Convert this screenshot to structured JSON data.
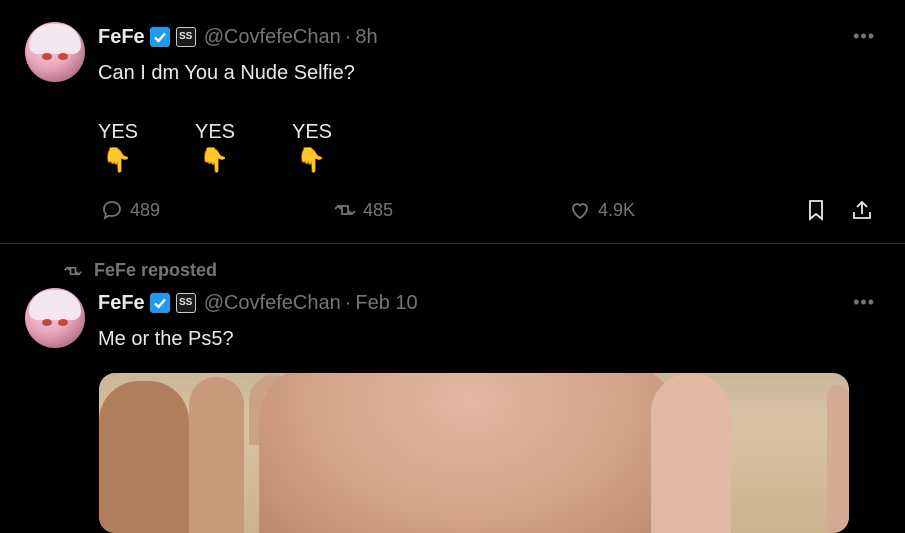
{
  "tweets": [
    {
      "name": "FeFe",
      "handle": "@CovfefeChan",
      "separator": "·",
      "time": "8h",
      "text": "Can I dm You a Nude Selfie?",
      "poll_options": [
        {
          "label": "YES",
          "emoji": "👇"
        },
        {
          "label": "YES",
          "emoji": "👇"
        },
        {
          "label": "YES",
          "emoji": "👇"
        }
      ],
      "replies": "489",
      "reposts": "485",
      "likes": "4.9K"
    },
    {
      "repost_label": "FeFe reposted",
      "name": "FeFe",
      "handle": "@CovfefeChan",
      "separator": "·",
      "time": "Feb 10",
      "text": "Me or the Ps5?"
    }
  ],
  "icons": {
    "verified": "verified-badge-icon",
    "affiliate": "affiliate-badge-icon",
    "more": "more-icon",
    "reply": "reply-icon",
    "repost": "repost-icon",
    "like": "heart-icon",
    "bookmark": "bookmark-icon",
    "share": "share-icon"
  },
  "colors": {
    "background": "#000000",
    "text": "#e7e9ea",
    "muted": "#71767b",
    "verified": "#1d9bf0",
    "divider": "#2f3336"
  }
}
